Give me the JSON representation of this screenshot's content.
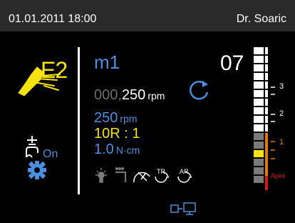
{
  "header": {
    "datetime": "01.01.2011  18:00",
    "user": "Dr. Soaric"
  },
  "handpiece": {
    "icon": "handpiece-icon",
    "label": "E2"
  },
  "light": {
    "icon": "light-icon",
    "state": "On"
  },
  "settings": {
    "icon": "gear-icon"
  },
  "program": {
    "name": "m1",
    "speed_prefix": "000,",
    "speed_value": "250",
    "speed_unit": "rpm",
    "rotation_icon": "rotation-cw-icon",
    "set_speed": "250",
    "set_speed_unit": "rpm",
    "ratio": "10R : 1",
    "torque": "1.0",
    "torque_unit": "N·cm"
  },
  "status_icons": [
    "light-icon",
    "spray-icon",
    "torque-limit-icon",
    "auto-reverse-tr-icon",
    "auto-reverse-ar-icon"
  ],
  "step": "07",
  "apex": {
    "labels": [
      "3",
      "2",
      "1",
      "Apex"
    ],
    "colors": {
      "white": "#ffffff",
      "yellow": "#f5e30f",
      "orange": "#e07a10",
      "red": "#d21a1a",
      "grey": "#7a7a7a"
    }
  },
  "footer": {
    "icon": "display-mode-icon"
  },
  "colors": {
    "accent_blue": "#4a8fe0",
    "accent_yellow": "#f5e30f",
    "header_bg": "#2a2a2a"
  }
}
